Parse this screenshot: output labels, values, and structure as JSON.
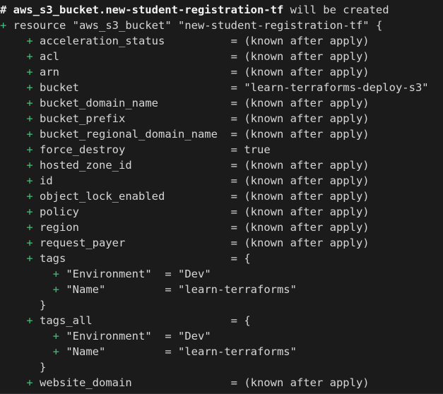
{
  "terminal": {
    "app": "terraform-plan-output",
    "background_color": "#1b1b1b",
    "text_color": "#d6d6d6",
    "accent_plus_color": "#3fc37a"
  },
  "header": {
    "hash": "#",
    "resource_address": "aws_s3_bucket.new-student-registration-tf",
    "action_text": "will be created"
  },
  "resource_block": {
    "plus": "+",
    "keyword": "resource",
    "type": "\"aws_s3_bucket\"",
    "name": "\"new-student-registration-tf\"",
    "open_brace": "{"
  },
  "separator": {
    "equals": "=",
    "open_brace": "{",
    "close_brace": "}"
  },
  "attributes": [
    {
      "plus": "+",
      "key": "acceleration_status",
      "value": "(known after apply)"
    },
    {
      "plus": "+",
      "key": "acl",
      "value": "(known after apply)"
    },
    {
      "plus": "+",
      "key": "arn",
      "value": "(known after apply)"
    },
    {
      "plus": "+",
      "key": "bucket",
      "value": "\"learn-terraforms-deploy-s3\""
    },
    {
      "plus": "+",
      "key": "bucket_domain_name",
      "value": "(known after apply)"
    },
    {
      "plus": "+",
      "key": "bucket_prefix",
      "value": "(known after apply)"
    },
    {
      "plus": "+",
      "key": "bucket_regional_domain_name",
      "value": "(known after apply)"
    },
    {
      "plus": "+",
      "key": "force_destroy",
      "value": "true"
    },
    {
      "plus": "+",
      "key": "hosted_zone_id",
      "value": "(known after apply)"
    },
    {
      "plus": "+",
      "key": "id",
      "value": "(known after apply)"
    },
    {
      "plus": "+",
      "key": "object_lock_enabled",
      "value": "(known after apply)"
    },
    {
      "plus": "+",
      "key": "policy",
      "value": "(known after apply)"
    },
    {
      "plus": "+",
      "key": "region",
      "value": "(known after apply)"
    },
    {
      "plus": "+",
      "key": "request_payer",
      "value": "(known after apply)"
    }
  ],
  "tags_block": {
    "plus": "+",
    "key": "tags",
    "entries": [
      {
        "plus": "+",
        "key": "\"Environment\"",
        "value": "\"Dev\""
      },
      {
        "plus": "+",
        "key": "\"Name\"",
        "value": "\"learn-terraforms\""
      }
    ]
  },
  "tags_all_block": {
    "plus": "+",
    "key": "tags_all",
    "entries": [
      {
        "plus": "+",
        "key": "\"Environment\"",
        "value": "\"Dev\""
      },
      {
        "plus": "+",
        "key": "\"Name\"",
        "value": "\"learn-terraforms\""
      }
    ]
  },
  "trailing_attributes": [
    {
      "plus": "+",
      "key": "website_domain",
      "value": "(known after apply)"
    }
  ],
  "layout": {
    "attr_indent": 4,
    "attr_key_width": 29,
    "tag_indent": 8,
    "tag_key_width": 15,
    "close_brace_indent": 6
  }
}
